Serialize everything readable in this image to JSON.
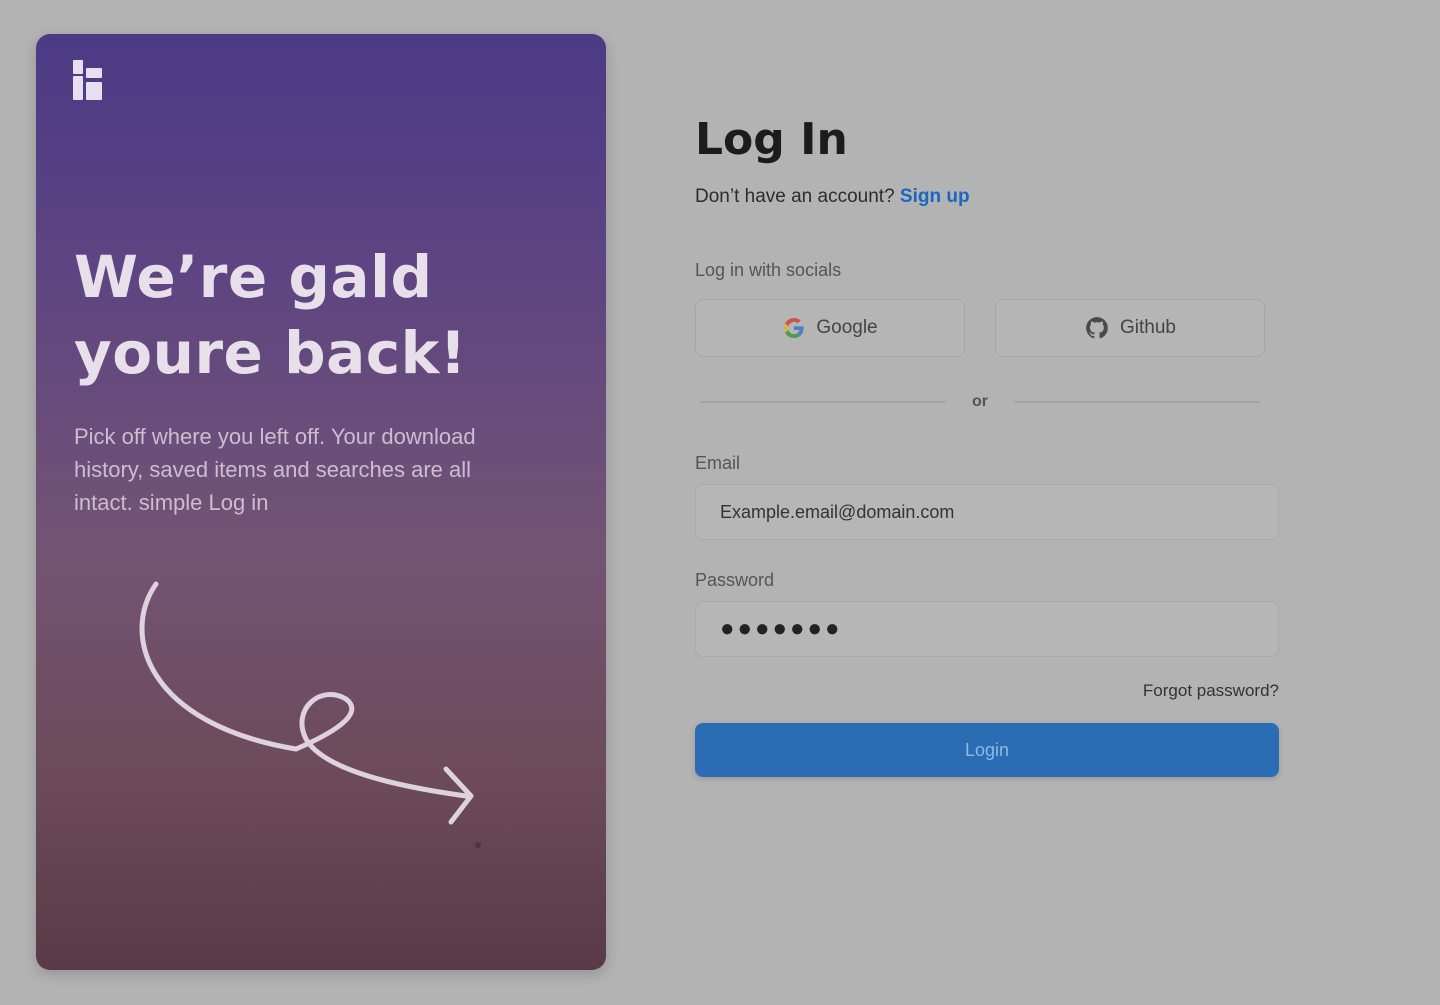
{
  "hero": {
    "title": "We’re gald youre back!",
    "description": "Pick off where you left off. Your download history, saved items and searches are all intact. simple Log in",
    "logo_icon": "brand-logo-icon",
    "gradient_top": "#4b3a85",
    "gradient_bottom": "#5a3a48"
  },
  "login": {
    "title": "Log In",
    "signup_prompt": "Don’t have an account?",
    "signup_link": "Sign up",
    "social_label": "Log in with socials",
    "social": [
      {
        "label": "Google",
        "icon": "google-icon"
      },
      {
        "label": "Github",
        "icon": "github-icon"
      }
    ],
    "divider": "or",
    "email_label": "Email",
    "email_value": "Example.email@domain.com",
    "password_label": "Password",
    "password_value": "●●●●●●●",
    "forgot": "Forgot password?",
    "submit": "Login",
    "accent": "#2a6db4",
    "link_color": "#1a67c0"
  }
}
